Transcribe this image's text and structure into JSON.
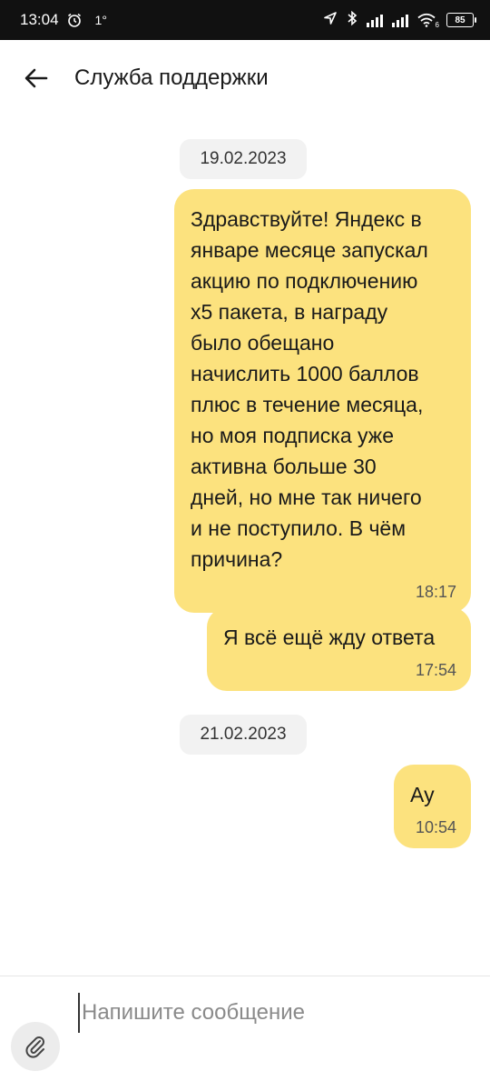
{
  "status_bar": {
    "time": "13:04",
    "temperature": "1°",
    "battery": "85",
    "signal_label_2": "6"
  },
  "header": {
    "title": "Служба поддержки"
  },
  "chat": {
    "groups": [
      {
        "date": "19.02.2023",
        "messages": [
          {
            "text": "Здравствуйте! Яндекс в\nянваре месяце запускал\nакцию по подключению\nх5 пакета, в награду\nбыло обещано\nначислить 1000 баллов\nплюс в течение месяца,\nно моя подписка уже\nактивна больше 30\nдней, но мне так ничего\nи не поступило. В чём\nпричина?",
            "time": "18:17"
          },
          {
            "text": "Я всё ещё жду ответа",
            "time": "17:54"
          }
        ]
      },
      {
        "date": "21.02.2023",
        "messages": [
          {
            "text": "Ау",
            "time": "10:54"
          }
        ]
      }
    ]
  },
  "composer": {
    "placeholder": "Напишите сообщение"
  },
  "colors": {
    "bubble": "#fce27e",
    "date_chip": "#f2f2f2",
    "status_bar": "#111111"
  }
}
